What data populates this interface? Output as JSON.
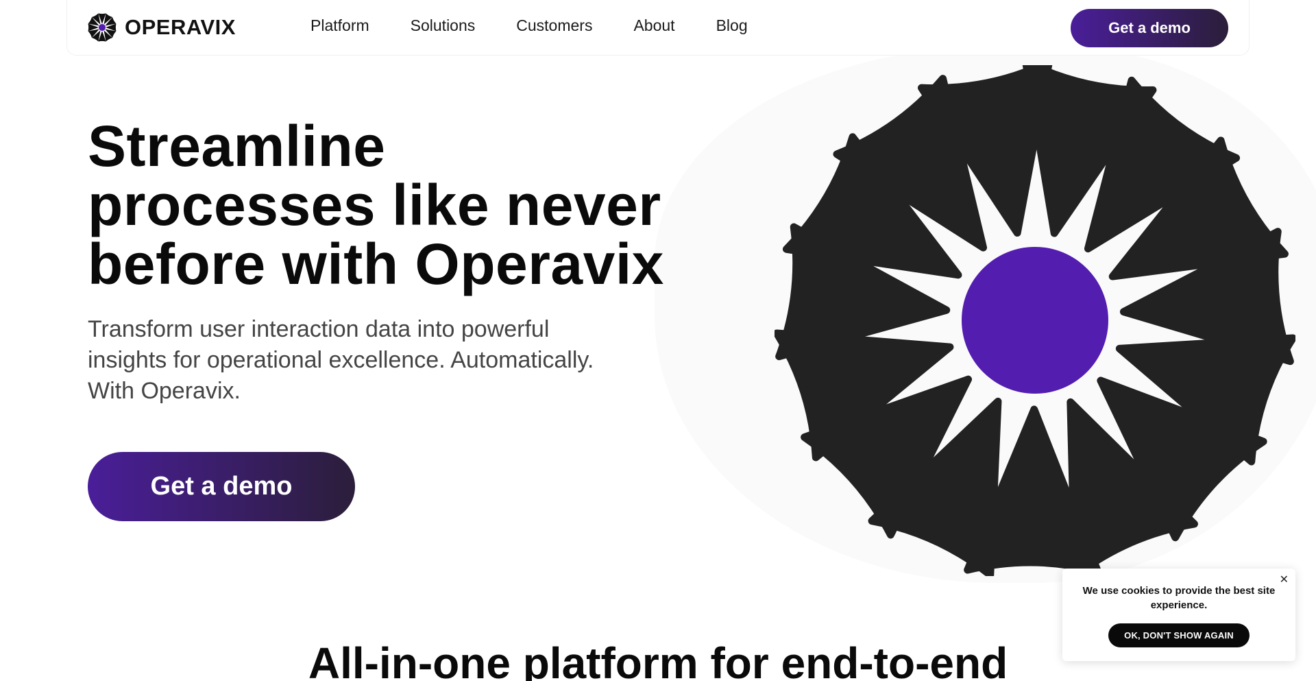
{
  "brand": {
    "name": "OPERAVIX",
    "logo_icon": "burst-logo-icon",
    "accent_color": "#4a1e99",
    "center_color": "#531db0",
    "petal_color": "#222222"
  },
  "nav": {
    "links": [
      "Platform",
      "Solutions",
      "Customers",
      "About",
      "Blog"
    ],
    "cta_label": "Get a demo"
  },
  "hero": {
    "title": "Streamline processes like never before with Operavix",
    "subtitle": "Transform user interaction data into powerful insights for operational excellence. Automatically. With Operavix.",
    "cta_label": "Get a demo",
    "graphic_icon": "burst-illustration"
  },
  "section": {
    "title": "All-in-one platform for end-to-end"
  },
  "cookie": {
    "message": "We use cookies to provide the best site experience.",
    "button_label": "OK, DON'T SHOW AGAIN",
    "close_icon": "close-icon",
    "close_glyph": "✕"
  }
}
